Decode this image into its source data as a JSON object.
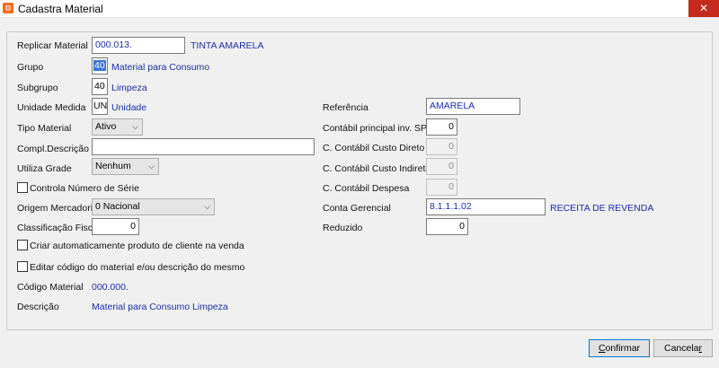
{
  "window": {
    "title": "Cadastra Material",
    "close_glyph": "✕"
  },
  "form": {
    "replicar": {
      "label": "Replicar Material",
      "value": "000.013.",
      "desc": "TINTA AMARELA"
    },
    "grupo": {
      "label": "Grupo",
      "value": "40",
      "desc": "Material para Consumo"
    },
    "subgrupo": {
      "label": "Subgrupo",
      "value": "40",
      "desc": "Limpeza"
    },
    "unidade": {
      "label": "Unidade Medida",
      "value": "UNI",
      "desc": "Unidade"
    },
    "tipo": {
      "label": "Tipo Material",
      "value": "Ativo"
    },
    "compl": {
      "label": "Compl.Descrição",
      "value": ""
    },
    "grade": {
      "label": "Utiliza Grade",
      "value": "Nenhum"
    },
    "serie": {
      "label": "Controla Número de Série"
    },
    "origem": {
      "label": "Origem Mercadoria",
      "value": "0 Nacional"
    },
    "classif": {
      "label": "Classificação Fiscal",
      "value": "0"
    },
    "criar": {
      "label": "Criar automaticamente produto de cliente na venda"
    },
    "editar": {
      "label": "Editar código do material e/ou descrição do mesmo"
    },
    "codigo": {
      "label": "Código Material",
      "value": "000.000."
    },
    "descricao": {
      "label": "Descrição",
      "value": "Material para Consumo Limpeza"
    },
    "referencia": {
      "label": "Referência",
      "value": "AMARELA"
    },
    "contabil_sped": {
      "label": "Contábil principal inv. SPED",
      "value": "0"
    },
    "custo_direto": {
      "label": "C. Contábil Custo Direto",
      "value": "0"
    },
    "custo_indireto": {
      "label": "C. Contábil Custo Indireto",
      "value": "0"
    },
    "despesa": {
      "label": "C. Contábil Despesa",
      "value": "0"
    },
    "gerencial": {
      "label": "Conta Gerencial",
      "value": "8.1.1.1.02",
      "desc": "RECEITA DE REVENDA"
    },
    "reduzido": {
      "label": "Reduzido",
      "value": "0"
    }
  },
  "buttons": {
    "confirm_first": "C",
    "confirm_rest": "onfirmar",
    "cancel_first": "Cancela",
    "cancel_last": "r"
  },
  "select_arrow": "⌵",
  "colors": {
    "value_text": "#1c2ea8",
    "close": "#c42b1c",
    "accent": "#0078d7"
  }
}
